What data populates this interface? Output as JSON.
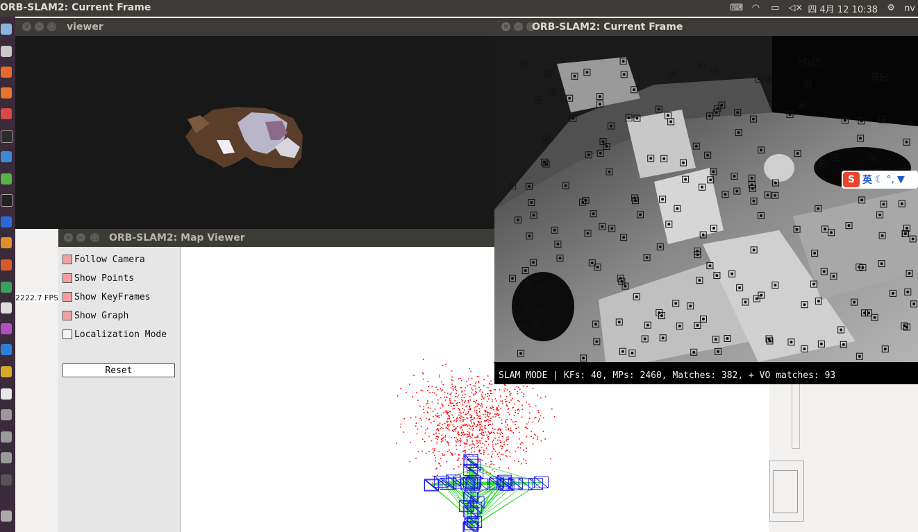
{
  "topbar": {
    "title": "ORB-SLAM2: Current Frame",
    "datetime": "四 4月 12 10:38",
    "user": "nv"
  },
  "viewer": {
    "title": "viewer",
    "fps": "2222.7 FPS"
  },
  "map_viewer": {
    "title": "ORB-SLAM2: Map Viewer",
    "options": [
      {
        "label": "Follow Camera",
        "checked": true
      },
      {
        "label": "Show Points",
        "checked": true
      },
      {
        "label": "Show KeyFrames",
        "checked": true
      },
      {
        "label": "Show Graph",
        "checked": true
      },
      {
        "label": "Localization Mode",
        "checked": false
      }
    ],
    "reset_label": "Reset"
  },
  "current_frame": {
    "title": "ORB-SLAM2: Current Frame",
    "status": "SLAM MODE |  KFs: 40, MPs: 2460, Matches: 382, + VO matches: 93"
  },
  "ime": {
    "lang": "英"
  },
  "colors": {
    "map_points": "#ff0000",
    "keyframes": "#0000ff",
    "graph": "#00dd00",
    "checkbox_on": "#f5a0a0"
  }
}
